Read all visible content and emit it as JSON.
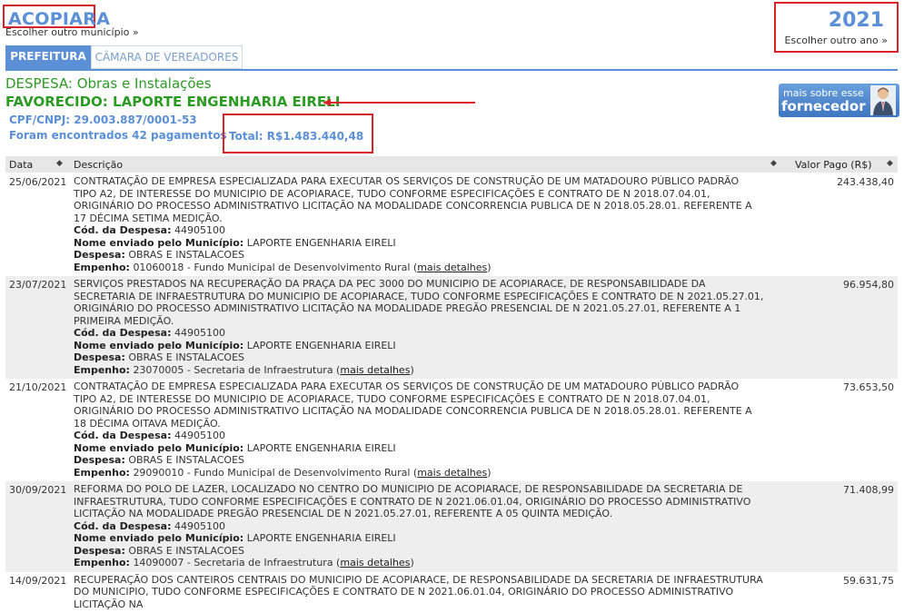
{
  "header": {
    "city": "ACOPIARA",
    "change_city": "Escolher outro município »",
    "year": "2021",
    "change_year": "Escolher outro ano »"
  },
  "tabs": [
    {
      "label": "PREFEITURA",
      "active": true
    },
    {
      "label": "CÂMARA DE VEREADORES",
      "active": false
    }
  ],
  "summary": {
    "despesa": "DESPESA: Obras e Instalações",
    "favorecido": "FAVORECIDO: LAPORTE ENGENHARIA EIRELI",
    "cnpj": "CPF/CNPJ: 29.003.887/0001-53",
    "found": "Foram encontrados 42 pagamentos",
    "total": "Total: R$1.483.440,48"
  },
  "more_button": {
    "line1": "mais sobre esse",
    "line2": "fornecedor"
  },
  "table": {
    "headers": {
      "date": "Data",
      "desc": "Descrição",
      "value": "Valor Pago (R$)"
    },
    "labels": {
      "cod": "Cód. da Despesa:",
      "nome": "Nome enviado pelo Município:",
      "despesa": "Despesa:",
      "empenho": "Empenho:",
      "more": "mais detalhes"
    },
    "rows": [
      {
        "date": "25/06/2021",
        "value": "243.438,40",
        "desc": "CONTRATAÇÃO DE EMPRESA ESPECIALIZADA PARA EXECUTAR OS SERVIÇOS DE CONSTRUÇÃO DE UM MATADOURO PÚBLICO PADRÃO TIPO A2, DE INTERESSE DO MUNICIPIO DE ACOPIARACE, TUDO CONFORME ESPECIFICAÇÕES E CONTRATO DE N 2018.07.04.01, ORIGINÁRIO DO PROCESSO ADMINISTRATIVO LICITAÇÃO NA MODALIDADE CONCORRENCIA PUBLICA DE N 2018.05.28.01. REFERENTE A 17 DÉCIMA SETIMA MEDIÇÃO.",
        "cod": "44905100",
        "nome": "LAPORTE ENGENHARIA EIRELI",
        "despesa": "OBRAS E INSTALACOES",
        "empenho": "01060018 - Fundo Municipal de Desenvolvimento Rural"
      },
      {
        "date": "23/07/2021",
        "value": "96.954,80",
        "desc": "SERVIÇOS PRESTADOS NA RECUPERAÇÃO DA PRAÇA DA PEC 3000 DO MUNICIPIO DE ACOPIARACE, DE RESPONSABILIDADE DA SECRETARIA DE INFRAESTRUTURA DO MUNICIPIO DE ACOPIARACE, TUDO CONFORME ESPECIFICAÇÕES E CONTRATO DE N 2021.05.27.01, ORIGINÁRIO DO PROCESSO ADMINISTRATIVO LICITAÇÃO NA MODALIDADE PREGÃO PRESENCIAL DE N 2021.05.27.01, REFERENTE A 1 PRIMEIRA MEDIÇÃO.",
        "cod": "44905100",
        "nome": "LAPORTE ENGENHARIA EIRELI",
        "despesa": "OBRAS E INSTALACOES",
        "empenho": "23070005 - Secretaria de Infraestrutura"
      },
      {
        "date": "21/10/2021",
        "value": "73.653,50",
        "desc": "CONTRATAÇÃO DE EMPRESA ESPECIALIZADA PARA EXECUTAR OS SERVIÇOS DE CONSTRUÇÃO DE UM MATADOURO PÚBLICO PADRÃO TIPO A2, DE INTERESSE DO MUNICIPIO DE ACOPIARACE, TUDO CONFORME ESPECIFICAÇÕES E CONTRATO DE N 2018.07.04.01, ORIGINÁRIO DO PROCESSO ADMINISTRATIVO LICITAÇÃO NA MODALIDADE CONCORRENCIA PUBLICA DE N 2018.05.28.01. REFERENTE A 18 DÉCIMA OITAVA MEDIÇÃO.",
        "cod": "44905100",
        "nome": "LAPORTE ENGENHARIA EIRELI",
        "despesa": "OBRAS E INSTALACOES",
        "empenho": "29090010 - Fundo Municipal de Desenvolvimento Rural"
      },
      {
        "date": "30/09/2021",
        "value": "71.408,99",
        "desc": "REFORMA DO POLO DE LAZER, LOCALIZADO NO CENTRO DO MUNICIPIO DE ACOPIARACE, DE RESPONSABILIDADE DA SECRETARIA DE INFRAESTRUTURA, TUDO CONFORME ESPECIFICAÇÕES E CONTRATO DE N 2021.06.01.04, ORIGINÁRIO DO PROCESSO ADMINISTRATIVO LICITAÇÃO NA MODALIDADE PREGÃO PRESENCIAL DE N 2021.05.27.01, REFERENTE A 05 QUINTA MEDIÇÃO.",
        "cod": "44905100",
        "nome": "LAPORTE ENGENHARIA EIRELI",
        "despesa": "OBRAS E INSTALACOES",
        "empenho": "14090007 - Secretaria de Infraestrutura"
      },
      {
        "date": "14/09/2021",
        "value": "59.631,75",
        "desc": "RECUPERAÇÃO DOS CANTEIROS CENTRAIS DO MUNICIPIO DE ACOPIARACE, DE RESPONSABILIDADE DA SECRETARIA DE INFRAESTRUTURA DO MUNICIPIO, TUDO CONFORME ESPECIFICAÇÕES E CONTRATO DE N 2021.06.01.04, ORIGINÁRIO DO PROCESSO ADMINISTRATIVO LICITAÇÃO NA",
        "cod": "",
        "nome": "",
        "despesa": "",
        "empenho": ""
      }
    ]
  }
}
